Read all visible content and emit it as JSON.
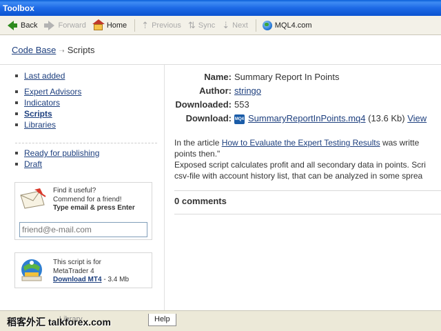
{
  "window": {
    "title": "Toolbox"
  },
  "toolbar": {
    "back": "Back",
    "forward": "Forward",
    "home": "Home",
    "previous": "Previous",
    "sync": "Sync",
    "next": "Next",
    "site": "MQL4.com"
  },
  "breadcrumb": {
    "root": "Code Base",
    "current": "Scripts"
  },
  "sidebar": {
    "last_added": "Last added",
    "categories": [
      "Expert Advisors",
      "Indicators",
      "Scripts",
      "Libraries"
    ],
    "publishing": [
      "Ready for publishing",
      "Draft"
    ],
    "recommend": {
      "line1": "Find it useful?",
      "line2": "Commend for a friend!",
      "line3": "Type email & press Enter",
      "placeholder": "friend@e-mail.com"
    },
    "mt4": {
      "line1": "This script is for",
      "line2": "MetaTrader 4",
      "download": "Download MT4",
      "size": " - 3.4 Mb"
    }
  },
  "details": {
    "name_label": "Name:",
    "name": "Summary Report In Points",
    "author_label": "Author:",
    "author": "stringo",
    "downloaded_label": "Downloaded:",
    "downloaded": "553",
    "download_label": "Download:",
    "file": "SummaryReportInPoints.mq4",
    "file_size": " (13.6 Kb) ",
    "view": "View"
  },
  "article": {
    "prefix": "In the article ",
    "link": "How to Evaluate the Expert Testing Results",
    "suffix": " was writte",
    "line2": "points then.\"",
    "line3": "Exposed script calculates profit and all secondary data in points. Scri",
    "line4": "csv-file with account history list, that can be analyzed in some sprea"
  },
  "comments": "0 comments",
  "bottom": {
    "library_tab": "Library",
    "help_tab": "Help"
  },
  "watermark": "稻客外汇 talkforex.com",
  "colors": {
    "link": "#1d3f7e",
    "titlebar": "#0b53d0"
  }
}
